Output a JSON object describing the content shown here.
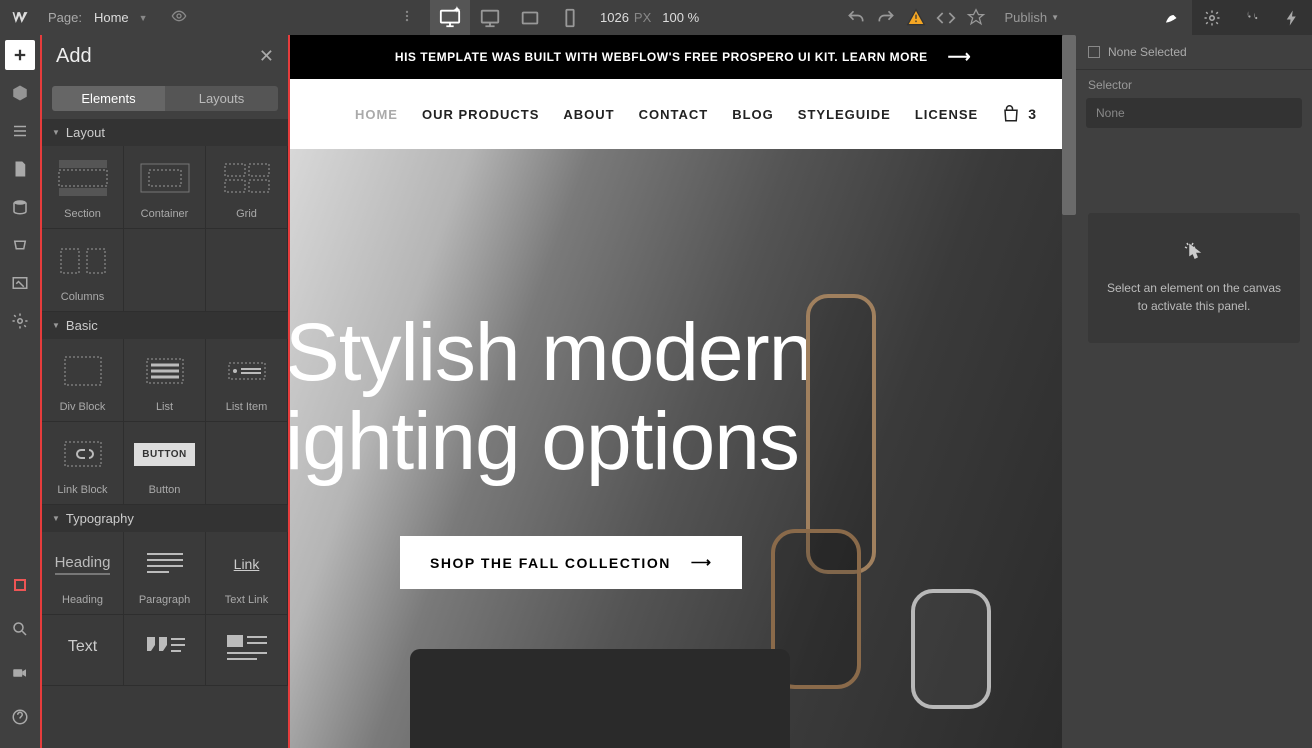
{
  "topbar": {
    "page_label": "Page:",
    "page_name": "Home",
    "width": "1026",
    "unit": "PX",
    "zoom": "100 %",
    "publish": "Publish"
  },
  "addpanel": {
    "title": "Add",
    "tabs": {
      "elements": "Elements",
      "layouts": "Layouts"
    },
    "sections": {
      "layout": {
        "title": "Layout",
        "items": [
          "Section",
          "Container",
          "Grid",
          "Columns"
        ]
      },
      "basic": {
        "title": "Basic",
        "items": [
          "Div Block",
          "List",
          "List Item",
          "Link Block",
          "Button"
        ],
        "button_label": "BUTTON"
      },
      "typography": {
        "title": "Typography",
        "items": [
          "Heading",
          "Paragraph",
          "Text Link",
          "Text"
        ],
        "heading_glyph": "Heading",
        "link_glyph": "Link",
        "text_glyph": "Text"
      }
    }
  },
  "canvas": {
    "announcement": "HIS TEMPLATE WAS BUILT WITH WEBFLOW'S FREE PROSPERO UI KIT. LEARN MORE",
    "nav": [
      "HOME",
      "OUR PRODUCTS",
      "ABOUT",
      "CONTACT",
      "BLOG",
      "STYLEGUIDE",
      "LICENSE"
    ],
    "cart_count": "3",
    "hero_title_1": "Stylish modern",
    "hero_title_2": "ighting options",
    "cta": "SHOP THE FALL COLLECTION"
  },
  "rpanel": {
    "none_selected": "None Selected",
    "selector_label": "Selector",
    "selector_value": "None",
    "empty_text": "Select an element on the canvas to activate this panel."
  }
}
